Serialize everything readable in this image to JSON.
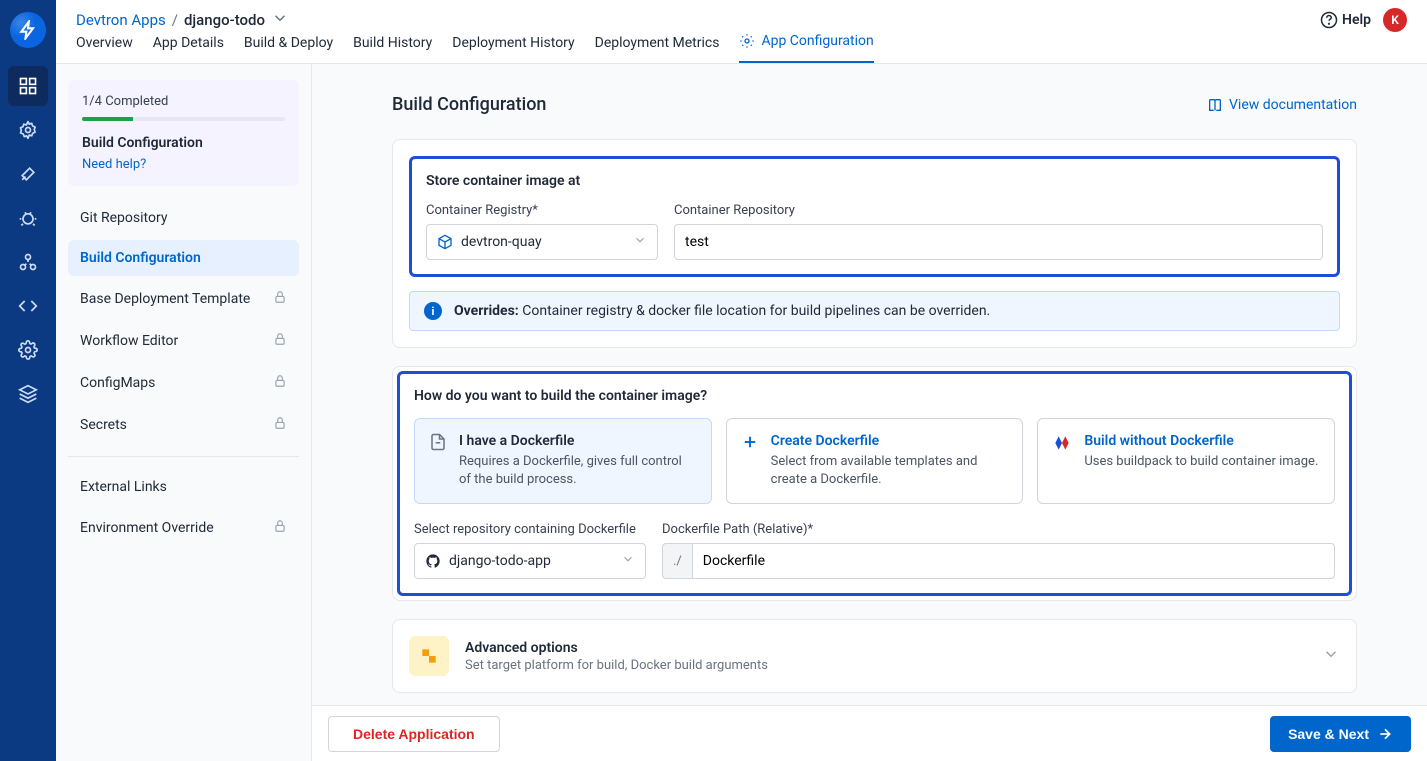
{
  "breadcrumb": {
    "root": "Devtron Apps",
    "sep": "/",
    "current": "django-todo"
  },
  "header": {
    "help": "Help",
    "avatar_initial": "K"
  },
  "tabs": [
    {
      "label": "Overview"
    },
    {
      "label": "App Details"
    },
    {
      "label": "Build & Deploy"
    },
    {
      "label": "Build History"
    },
    {
      "label": "Deployment History"
    },
    {
      "label": "Deployment Metrics"
    },
    {
      "label": "App Configuration"
    }
  ],
  "sidebar": {
    "progress_text": "1/4 Completed",
    "progress_title": "Build Configuration",
    "need_help": "Need help?",
    "items": [
      {
        "label": "Git Repository",
        "locked": false
      },
      {
        "label": "Build Configuration",
        "locked": false
      },
      {
        "label": "Base Deployment Template",
        "locked": true
      },
      {
        "label": "Workflow Editor",
        "locked": true
      },
      {
        "label": "ConfigMaps",
        "locked": true
      },
      {
        "label": "Secrets",
        "locked": true
      }
    ],
    "extra": [
      {
        "label": "External Links",
        "locked": false
      },
      {
        "label": "Environment Override",
        "locked": true
      }
    ]
  },
  "page": {
    "title": "Build Configuration",
    "docs_link": "View documentation"
  },
  "store_section": {
    "title": "Store container image at",
    "registry_label": "Container Registry*",
    "registry_value": "devtron-quay",
    "repository_label": "Container Repository",
    "repository_value": "test"
  },
  "banner": {
    "label": "Overrides:",
    "text": "Container registry & docker file location for build pipelines can be overriden."
  },
  "build_section": {
    "title": "How do you want to build the container image?",
    "options": [
      {
        "title": "I have a Dockerfile",
        "desc": "Requires a Dockerfile, gives full control of the build process."
      },
      {
        "title": "Create Dockerfile",
        "desc": "Select from available templates and create a Dockerfile."
      },
      {
        "title": "Build without Dockerfile",
        "desc": "Uses buildpack to build container image."
      }
    ],
    "repo_label": "Select repository containing Dockerfile",
    "repo_value": "django-todo-app",
    "path_label": "Dockerfile Path (Relative)*",
    "path_prefix": "./",
    "path_value": "Dockerfile"
  },
  "advanced": {
    "title": "Advanced options",
    "desc": "Set target platform for build, Docker build arguments"
  },
  "footer": {
    "delete": "Delete Application",
    "save": "Save & Next"
  }
}
